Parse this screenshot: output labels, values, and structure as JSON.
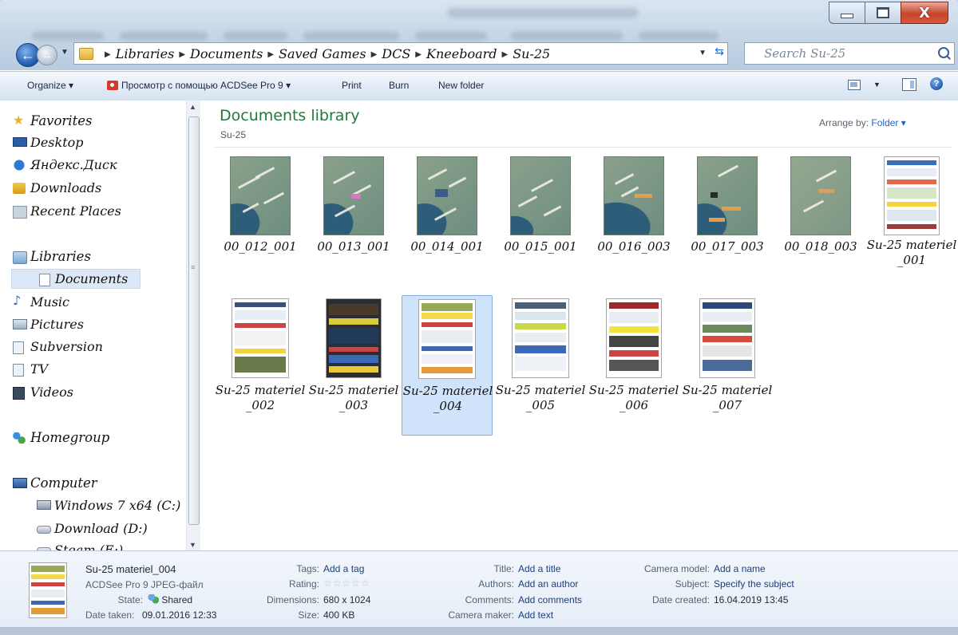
{
  "window": {
    "controls": [
      "minimize-icon",
      "maximize-icon",
      "close-icon"
    ]
  },
  "address": {
    "crumbs": [
      "Libraries",
      "Documents",
      "Saved Games",
      "DCS",
      "Kneeboard",
      "Su-25"
    ]
  },
  "search": {
    "placeholder": "Search Su-25"
  },
  "toolbar": {
    "organize": "Organize ▾",
    "acdsee": "Просмотр с помощью ACDSee Pro 9 ▾",
    "print": "Print",
    "burn": "Burn",
    "new_folder": "New folder"
  },
  "sidebar": {
    "favorites": "Favorites",
    "desktop": "Desktop",
    "yandex": "Яндекс.Диск",
    "downloads": "Downloads",
    "recent": "Recent Places",
    "libraries": "Libraries",
    "documents": "Documents",
    "music": "Music",
    "pictures": "Pictures",
    "subversion": "Subversion",
    "tv": "TV",
    "videos": "Videos",
    "homegroup": "Homegroup",
    "computer": "Computer",
    "drive_c": "Windows 7 x64 (C:)",
    "drive_d": "Download (D:)",
    "drive_e": "Steam (E:)"
  },
  "library": {
    "title": "Documents library",
    "subtitle": "Su-25",
    "arrange_label": "Arrange by:",
    "arrange_value": "Folder ▾"
  },
  "files": [
    {
      "name": "00_012_001"
    },
    {
      "name": "00_013_001"
    },
    {
      "name": "00_014_001"
    },
    {
      "name": "00_015_001"
    },
    {
      "name": "00_016_003"
    },
    {
      "name": "00_017_003"
    },
    {
      "name": "00_018_003"
    },
    {
      "name": "Su-25 materiel_001"
    },
    {
      "name": "Su-25 materiel_002"
    },
    {
      "name": "Su-25 materiel_003"
    },
    {
      "name": "Su-25 materiel_004",
      "selected": true
    },
    {
      "name": "Su-25 materiel_005"
    },
    {
      "name": "Su-25 materiel_006"
    },
    {
      "name": "Su-25 materiel_007"
    }
  ],
  "details": {
    "name": "Su-25 materiel_004",
    "type": "ACDSee Pro 9 JPEG-файл",
    "state_label": "State:",
    "state_value": "Shared",
    "date_taken_label": "Date taken:",
    "date_taken_value": "09.01.2016 12:33",
    "tags_label": "Tags:",
    "tags_value": "Add a tag",
    "rating_label": "Rating:",
    "rating_value": "☆☆☆☆☆",
    "dimensions_label": "Dimensions:",
    "dimensions_value": "680 x 1024",
    "size_label": "Size:",
    "size_value": "400 KB",
    "title_label": "Title:",
    "title_value": "Add a title",
    "authors_label": "Authors:",
    "authors_value": "Add an author",
    "comments_label": "Comments:",
    "comments_value": "Add comments",
    "camera_maker_label": "Camera maker:",
    "camera_maker_value": "Add text",
    "camera_model_label": "Camera model:",
    "camera_model_value": "Add a name",
    "subject_label": "Subject:",
    "subject_value": "Specify the subject",
    "date_created_label": "Date created:",
    "date_created_value": "16.04.2019 13:45"
  },
  "colors": {
    "library_title": "#1f7a3c",
    "link": "#1e64c8",
    "selection": "#cfe3fb"
  }
}
